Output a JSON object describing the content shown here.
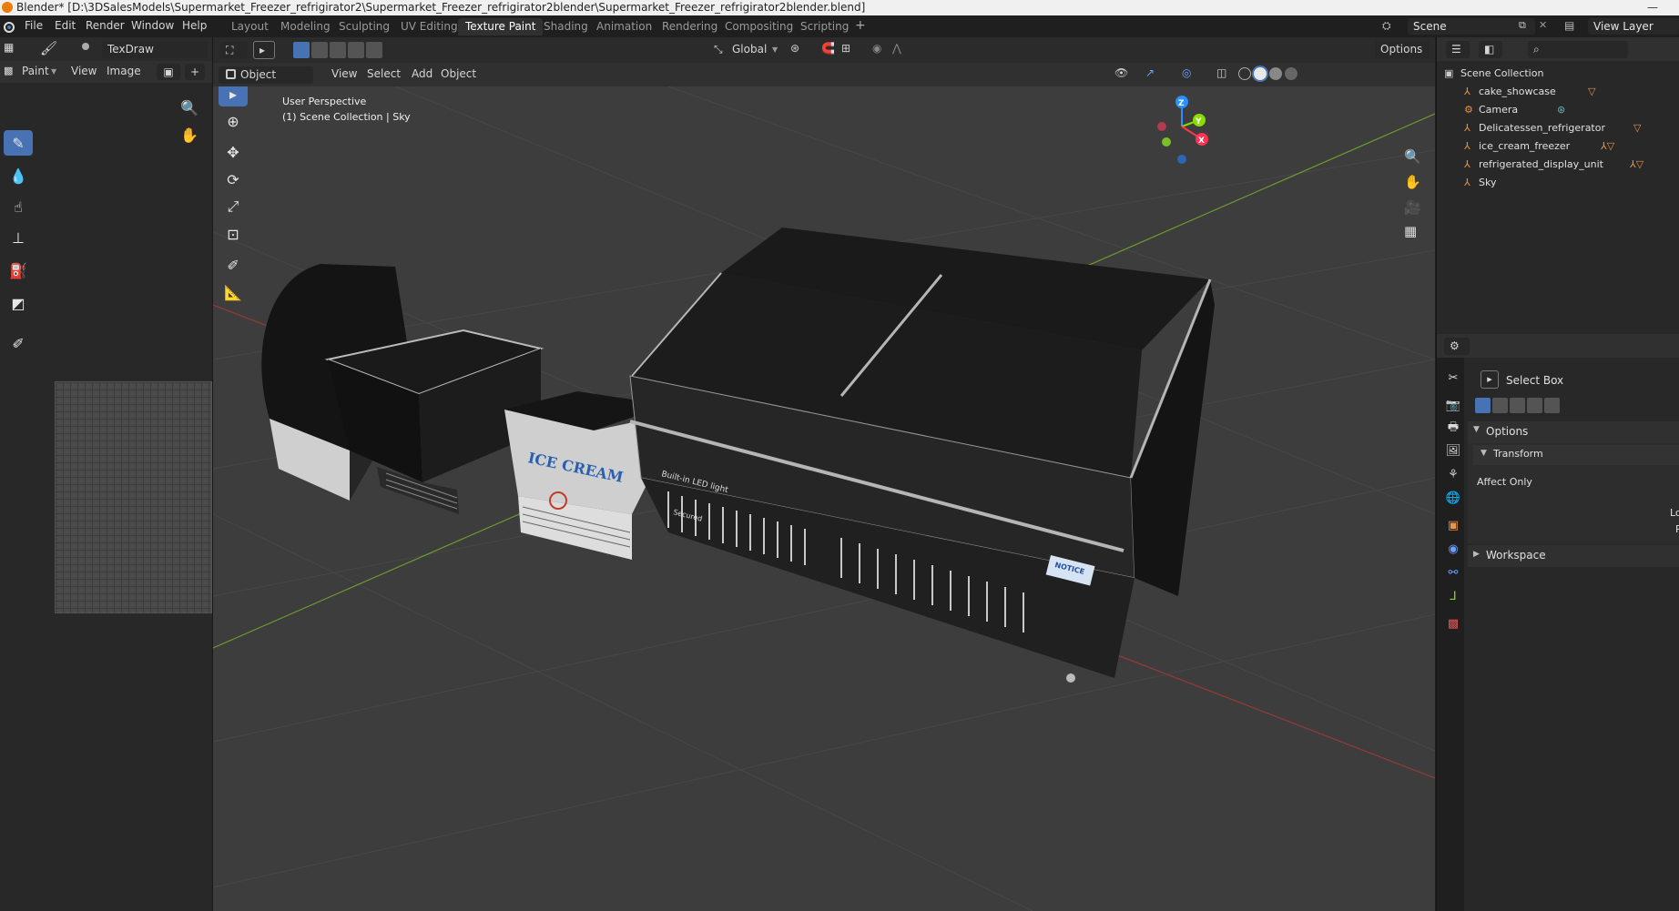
{
  "window": {
    "title": "Blender* [D:\\3DSalesModels\\Supermarket_Freezer_refrigirator2\\Supermarket_Freezer_refrigirator2blender\\Supermarket_Freezer_refrigirator2blender.blend]",
    "minimize": "—"
  },
  "menu": {
    "file": "File",
    "edit": "Edit",
    "render": "Render",
    "window": "Window",
    "help": "Help"
  },
  "workspaces": [
    "Layout",
    "Modeling",
    "Sculpting",
    "UV Editing",
    "Texture Paint",
    "Shading",
    "Animation",
    "Rendering",
    "Compositing",
    "Scripting"
  ],
  "workspace_active": "Texture Paint",
  "add_workspace": "+",
  "scene": {
    "name": "Scene",
    "view_layer": "View Layer"
  },
  "image_editor": {
    "brush_name": "TexDraw",
    "mode": "Paint",
    "view": "View",
    "image": "Image",
    "new": "+"
  },
  "viewport_header": {
    "orientation": "Global",
    "options": "Options",
    "mode": "Object Mode",
    "view": "View",
    "select": "Select",
    "add": "Add",
    "object": "Object"
  },
  "viewport": {
    "perspective": "User Perspective",
    "collection_info": "(1) Scene Collection | Sky",
    "gizmo_axes": {
      "x": "X",
      "y": "Y",
      "z": "Z"
    }
  },
  "scene_text": {
    "ice_cream": "ICE CREAM",
    "led": "Built-in LED light",
    "secured": "Secured",
    "notice": "NOTICE"
  },
  "outliner": {
    "root": "Scene Collection",
    "items": [
      {
        "name": "cake_showcase",
        "badge": "2"
      },
      {
        "name": "Camera",
        "badge": ""
      },
      {
        "name": "Delicatessen_refrigerator",
        "badge": "2"
      },
      {
        "name": "ice_cream_freezer",
        "badge": "2  9"
      },
      {
        "name": "refrigerated_display_unit",
        "badge": "2  9"
      },
      {
        "name": "Sky",
        "badge": ""
      }
    ]
  },
  "properties": {
    "tool_name": "Select Box",
    "options_panel": "Options",
    "transform_panel": "Transform",
    "affect_only": "Affect Only",
    "truncated_1": "Lo",
    "truncated_2": "P",
    "workspace_panel": "Workspace"
  },
  "colors": {
    "accent": "#4772b3",
    "header": "#303030",
    "viewport_bg": "#3d3d3d",
    "axis_x": "#ff3352",
    "axis_y": "#8bdc00",
    "axis_z": "#2890ff"
  },
  "icons": {
    "tools_left": [
      "brush-icon",
      "soften-icon",
      "smear-icon",
      "clone-icon",
      "fill-icon",
      "mask-icon",
      "annotate-icon"
    ],
    "tools_viewport": [
      "select-box-icon",
      "cursor-icon",
      "move-icon",
      "rotate-icon",
      "scale-icon",
      "transform-icon",
      "annotate-icon",
      "measure-icon"
    ],
    "properties_tabs": [
      "tool-icon",
      "render-icon",
      "output-icon",
      "view-layer-icon",
      "scene-icon",
      "world-icon",
      "object-icon",
      "modifier-icon",
      "physics-icon",
      "constraints-icon",
      "data-icon",
      "texture-icon"
    ]
  }
}
